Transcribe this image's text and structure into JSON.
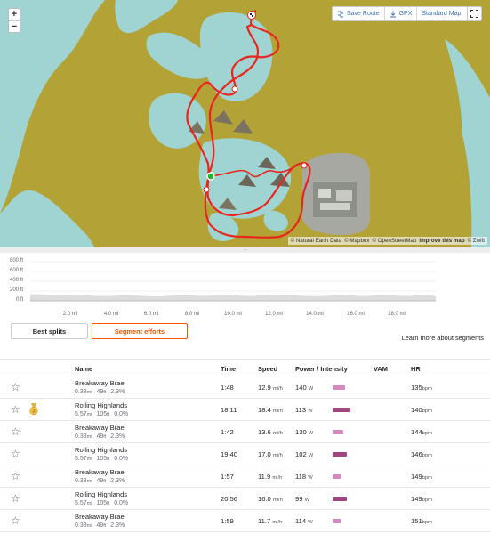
{
  "map": {
    "zoom_in": "+",
    "zoom_out": "−",
    "toolbar": {
      "save_route": "Save Route",
      "gpx": "GPX",
      "map_style": "Standard Map"
    },
    "attribution": {
      "natural_earth": "© Natural Earth Data",
      "mapbox": "© Mapbox",
      "osm": "© OpenStreetMap",
      "improve": "Improve this map",
      "zwift": "© Zwift"
    },
    "colors": {
      "land": "#b3a337",
      "water": "#9fd4d2",
      "route": "#e8261e",
      "start": "#2db135"
    },
    "icons": [
      "finish-flag-icon",
      "start-marker-icon",
      "save-route-icon",
      "download-icon",
      "chevron-down-icon",
      "fullscreen-icon"
    ]
  },
  "elevation": {
    "y_ticks": [
      "800 ft",
      "600 ft",
      "400 ft",
      "200 ft",
      "0 ft"
    ],
    "x_ticks": [
      "2.0 mi",
      "4.0 mi",
      "6.0 mi",
      "8.0 mi",
      "10.0 mi",
      "12.0 mi",
      "14.0 mi",
      "16.0 mi",
      "18.0 mi"
    ]
  },
  "tabs": {
    "best_splits": "Best splits",
    "segment_efforts": "Segment efforts",
    "active": "segment_efforts"
  },
  "learn_more": "Learn more about segments",
  "table": {
    "headers": {
      "name": "Name",
      "time": "Time",
      "speed": "Speed",
      "power": "Power / Intensity",
      "vam": "VAM",
      "hr": "HR"
    },
    "rows": [
      {
        "name": "Breakaway Brae",
        "dist": "0.38",
        "dist_unit": "mi",
        "elev": "49",
        "elev_unit": "ft",
        "grade": "2.3%",
        "time": "1:48",
        "speed": "12.9",
        "speed_unit": "mi/h",
        "power": "140",
        "power_unit": "W",
        "intensity": 0.3,
        "hr": "135",
        "hr_unit": "bpm",
        "medal": ""
      },
      {
        "name": "Rolling Highlands",
        "dist": "5.57",
        "dist_unit": "mi",
        "elev": "105",
        "elev_unit": "ft",
        "grade": "0.0%",
        "time": "18:11",
        "speed": "18.4",
        "speed_unit": "mi/h",
        "power": "113",
        "power_unit": "W",
        "intensity": 0.42,
        "hr": "140",
        "hr_unit": "bpm",
        "medal": "3"
      },
      {
        "name": "Breakaway Brae",
        "dist": "0.38",
        "dist_unit": "mi",
        "elev": "49",
        "elev_unit": "ft",
        "grade": "2.3%",
        "time": "1:42",
        "speed": "13.6",
        "speed_unit": "mi/h",
        "power": "130",
        "power_unit": "W",
        "intensity": 0.25,
        "hr": "144",
        "hr_unit": "bpm",
        "medal": ""
      },
      {
        "name": "Rolling Highlands",
        "dist": "5.57",
        "dist_unit": "mi",
        "elev": "105",
        "elev_unit": "ft",
        "grade": "0.0%",
        "time": "19:40",
        "speed": "17.0",
        "speed_unit": "mi/h",
        "power": "102",
        "power_unit": "W",
        "intensity": 0.34,
        "hr": "146",
        "hr_unit": "bpm",
        "medal": ""
      },
      {
        "name": "Breakaway Brae",
        "dist": "0.38",
        "dist_unit": "mi",
        "elev": "49",
        "elev_unit": "ft",
        "grade": "2.3%",
        "time": "1:57",
        "speed": "11.9",
        "speed_unit": "mi/h",
        "power": "118",
        "power_unit": "W",
        "intensity": 0.2,
        "hr": "149",
        "hr_unit": "bpm",
        "medal": ""
      },
      {
        "name": "Rolling Highlands",
        "dist": "5.57",
        "dist_unit": "mi",
        "elev": "105",
        "elev_unit": "ft",
        "grade": "0.0%",
        "time": "20:56",
        "speed": "16.0",
        "speed_unit": "mi/h",
        "power": "99",
        "power_unit": "W",
        "intensity": 0.34,
        "hr": "149",
        "hr_unit": "bpm",
        "medal": ""
      },
      {
        "name": "Breakaway Brae",
        "dist": "0.38",
        "dist_unit": "mi",
        "elev": "49",
        "elev_unit": "ft",
        "grade": "2.3%",
        "time": "1:59",
        "speed": "11.7",
        "speed_unit": "mi/h",
        "power": "114",
        "power_unit": "W",
        "intensity": 0.2,
        "hr": "151",
        "hr_unit": "bpm",
        "medal": ""
      }
    ]
  }
}
